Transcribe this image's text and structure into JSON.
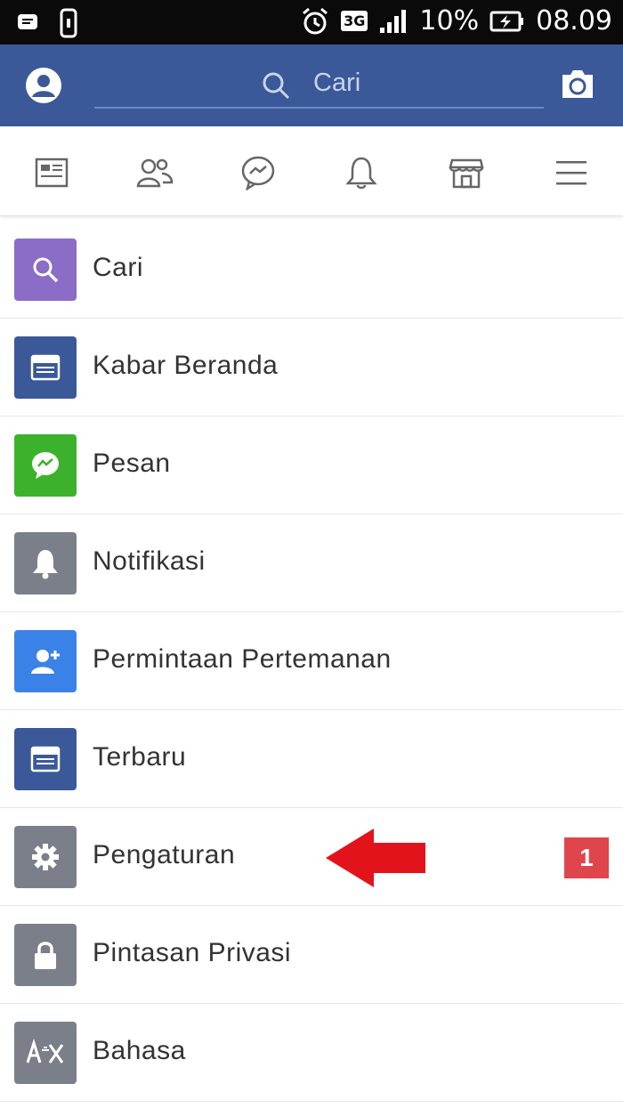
{
  "status_bar": {
    "lte": "3G",
    "battery_percent": "10%",
    "time": "08.09"
  },
  "header": {
    "search_placeholder": "Cari"
  },
  "nav_tabs": [
    {
      "icon": "news-feed-icon"
    },
    {
      "icon": "friends-icon"
    },
    {
      "icon": "messenger-icon"
    },
    {
      "icon": "bell-icon"
    },
    {
      "icon": "marketplace-icon"
    },
    {
      "icon": "menu-icon"
    }
  ],
  "menu": {
    "items": [
      {
        "label": "Cari",
        "color": "#8b6cc6",
        "icon": "search-icon"
      },
      {
        "label": "Kabar Beranda",
        "color": "#3b5998",
        "icon": "news-feed-icon"
      },
      {
        "label": "Pesan",
        "color": "#3cb22c",
        "icon": "messenger-icon"
      },
      {
        "label": "Notifikasi",
        "color": "#7b7f8a",
        "icon": "bell-icon"
      },
      {
        "label": "Permintaan Pertemanan",
        "color": "#3b82e8",
        "icon": "add-friend-icon"
      },
      {
        "label": "Terbaru",
        "color": "#3b5998",
        "icon": "news-feed-icon"
      },
      {
        "label": "Pengaturan",
        "color": "#7b7f8a",
        "icon": "gear-icon",
        "badge": "1"
      },
      {
        "label": "Pintasan Privasi",
        "color": "#7b7f8a",
        "icon": "lock-icon"
      },
      {
        "label": "Bahasa",
        "color": "#7b7f8a",
        "icon": "language-icon"
      }
    ]
  },
  "colors": {
    "header_bg": "#3b5998",
    "badge": "#e0454b",
    "annotation_arrow": "#e3131b"
  }
}
